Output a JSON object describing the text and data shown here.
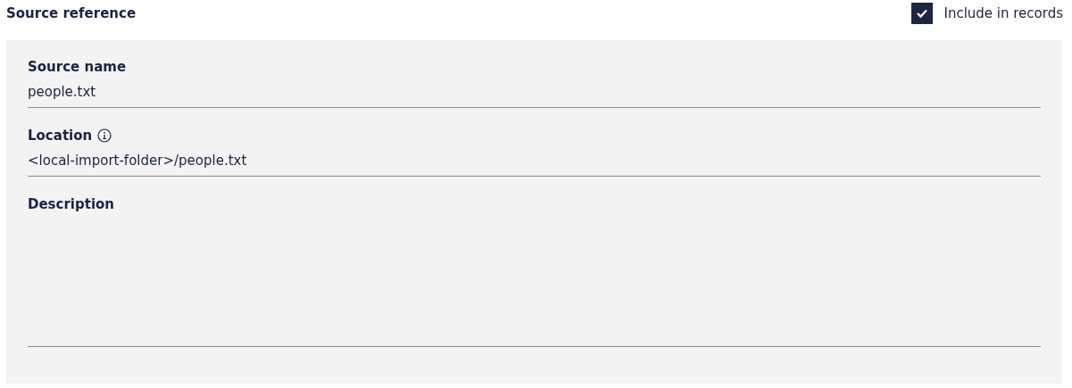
{
  "header": {
    "title": "Source reference",
    "include_checkbox": {
      "label": "Include in records",
      "checked": true
    }
  },
  "fields": [
    {
      "kind": "input",
      "label": "Source name",
      "value": "people.txt",
      "info": false
    },
    {
      "kind": "input",
      "label": "Location",
      "value": "<local-import-folder>/people.txt",
      "info": true
    },
    {
      "kind": "textarea",
      "label": "Description",
      "info": false
    }
  ]
}
